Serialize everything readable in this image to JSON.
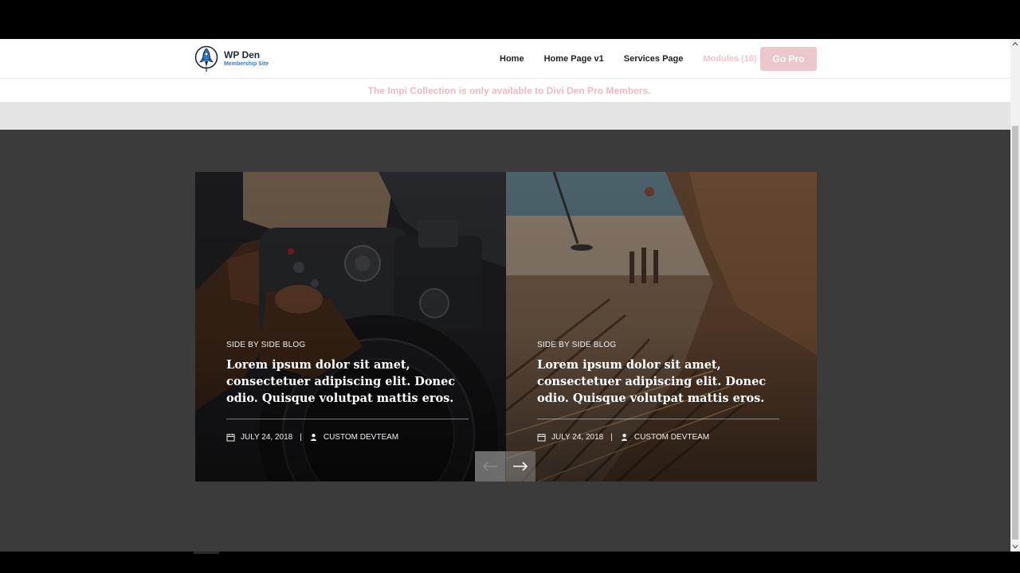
{
  "brand": {
    "title": "WP Den",
    "subtitle": "Membership Site"
  },
  "nav": {
    "items": [
      {
        "label": "Home"
      },
      {
        "label": "Home Page v1"
      },
      {
        "label": "Services Page"
      },
      {
        "label": "Modules (16)"
      }
    ],
    "cta_label": "Go Pro"
  },
  "notice": {
    "text": "The Impi Collection is only available to Divi Den Pro Members."
  },
  "slides": [
    {
      "category": "SIDE BY SIDE BLOG",
      "title": "Lorem ipsum dolor sit amet, consectetuer adipiscing elit. Donec odio. Quisque volutpat mattis eros.",
      "date": "JULY 24, 2018",
      "separator": "|",
      "author": "CUSTOM DEVTEAM"
    },
    {
      "category": "SIDE BY SIDE BLOG",
      "title": "Lorem ipsum dolor sit amet, consectetuer adipiscing elit. Donec odio. Quisque volutpat mattis eros.",
      "date": "JULY 24, 2018",
      "separator": "|",
      "author": "CUSTOM DEVTEAM"
    }
  ],
  "icons": {
    "logo": "rocket-badge-icon",
    "modules_chevron": "chevron-down-icon",
    "date": "calendar-icon",
    "author": "user-icon",
    "prev": "arrow-left-icon",
    "next": "arrow-right-icon"
  },
  "colors": {
    "accent_pink": "#ebc6cb",
    "notice_pink": "#efbac3",
    "logo_blue": "#2b7bd6",
    "section_bg": "#3b3b3b"
  }
}
